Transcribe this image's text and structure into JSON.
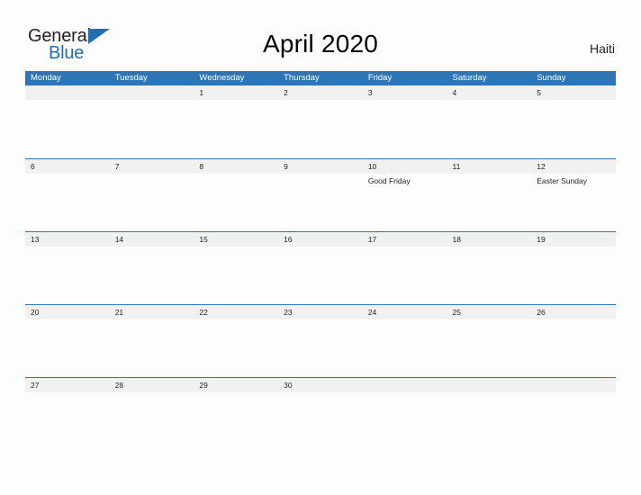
{
  "logo": {
    "word_one": "General",
    "word_two": "Blue",
    "flag_icon": "blue-triangle-flag",
    "color_dark": "#231f20",
    "color_blue": "#1f6fb2"
  },
  "header": {
    "title": "April 2020",
    "region": "Haiti"
  },
  "theme": {
    "header_blue": "#2e75b6",
    "band_gray": "#f1f1f1",
    "page_bg": "#fdfdfd",
    "text": "#231f20"
  },
  "calendar": {
    "weekdays": [
      "Monday",
      "Tuesday",
      "Wednesday",
      "Thursday",
      "Friday",
      "Saturday",
      "Sunday"
    ],
    "weeks": [
      [
        {
          "day": "",
          "events": []
        },
        {
          "day": "",
          "events": []
        },
        {
          "day": "1",
          "events": []
        },
        {
          "day": "2",
          "events": []
        },
        {
          "day": "3",
          "events": []
        },
        {
          "day": "4",
          "events": []
        },
        {
          "day": "5",
          "events": []
        }
      ],
      [
        {
          "day": "6",
          "events": []
        },
        {
          "day": "7",
          "events": []
        },
        {
          "day": "8",
          "events": []
        },
        {
          "day": "9",
          "events": []
        },
        {
          "day": "10",
          "events": [
            "Good Friday"
          ]
        },
        {
          "day": "11",
          "events": []
        },
        {
          "day": "12",
          "events": [
            "Easter Sunday"
          ]
        }
      ],
      [
        {
          "day": "13",
          "events": []
        },
        {
          "day": "14",
          "events": []
        },
        {
          "day": "15",
          "events": []
        },
        {
          "day": "16",
          "events": []
        },
        {
          "day": "17",
          "events": []
        },
        {
          "day": "18",
          "events": []
        },
        {
          "day": "19",
          "events": []
        }
      ],
      [
        {
          "day": "20",
          "events": []
        },
        {
          "day": "21",
          "events": []
        },
        {
          "day": "22",
          "events": []
        },
        {
          "day": "23",
          "events": []
        },
        {
          "day": "24",
          "events": []
        },
        {
          "day": "25",
          "events": []
        },
        {
          "day": "26",
          "events": []
        }
      ],
      [
        {
          "day": "27",
          "events": []
        },
        {
          "day": "28",
          "events": []
        },
        {
          "day": "29",
          "events": []
        },
        {
          "day": "30",
          "events": []
        },
        {
          "day": "",
          "events": []
        },
        {
          "day": "",
          "events": []
        },
        {
          "day": "",
          "events": []
        }
      ]
    ]
  }
}
